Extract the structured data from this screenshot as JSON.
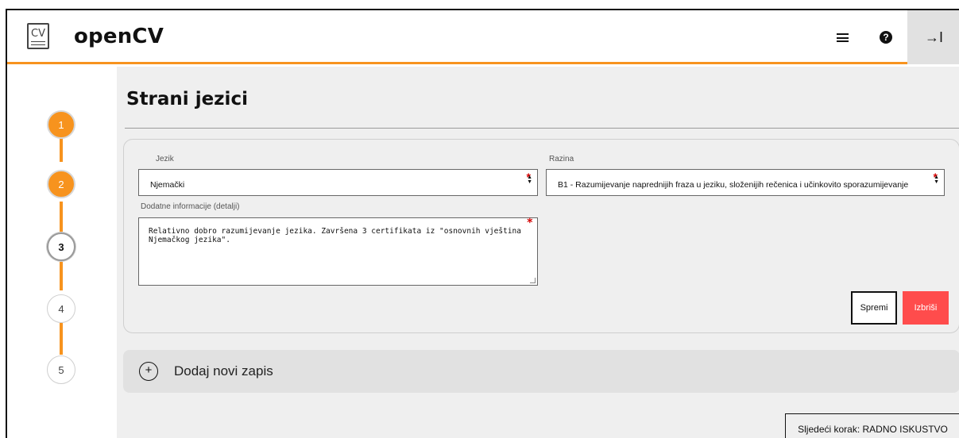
{
  "header": {
    "logo_text": "CV",
    "brand": "openCV",
    "menu_icon": "hamburger-menu-icon",
    "help_icon": "question-circle-icon",
    "help_glyph": "?",
    "exit_icon": "arrow-to-right-icon",
    "exit_glyph": "→I"
  },
  "steps": [
    {
      "label": "1",
      "state": "done"
    },
    {
      "label": "2",
      "state": "done"
    },
    {
      "label": "3",
      "state": "current"
    },
    {
      "label": "4",
      "state": "todo"
    },
    {
      "label": "5",
      "state": "todo"
    }
  ],
  "page": {
    "title": "Strani jezici"
  },
  "form": {
    "language_label": "Jezik",
    "language_value": "Njemački",
    "level_label": "Razina",
    "level_value": "B1 - Razumijevanje naprednijih fraza u jeziku, složenijih rečenica i učinkovito sporazumijevanje",
    "details_label": "Dodatne informacije (detalji)",
    "details_value": "Relativno dobro razumijevanje jezika. Završena 3 certifikata iz \"osnovnih vještina Njemačkog jezika\".",
    "required_mark": "*",
    "save_label": "Spremi",
    "delete_label": "Izbriši"
  },
  "add_entry": {
    "icon_glyph": "+",
    "label": "Dodaj novi zapis"
  },
  "next_step": {
    "label": "Sljedeći korak: RADNO ISKUSTVO"
  },
  "colors": {
    "accent": "#f7931e",
    "danger": "#ff4c4c",
    "panel": "#efefef"
  }
}
